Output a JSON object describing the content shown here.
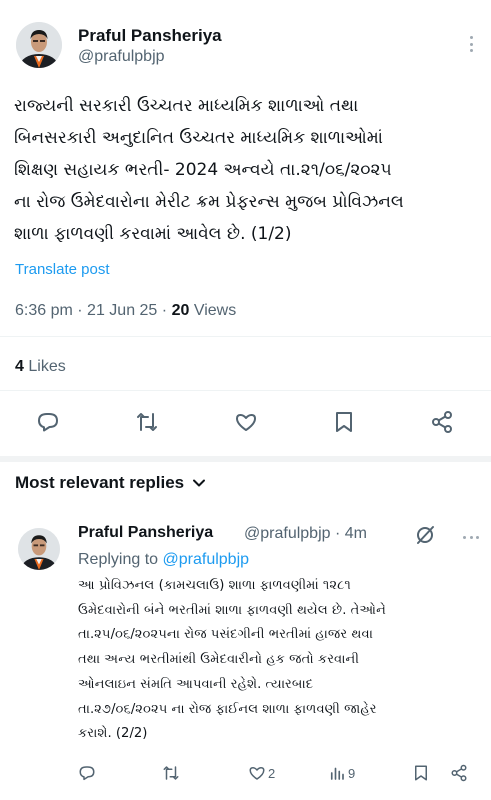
{
  "post": {
    "author_name": "Praful Pansheriya",
    "author_handle": "@prafulpbjp",
    "body_lines": [
      "રાજ્યની સરકારી ઉચ્ચતર માધ્યમિક શાળાઓ તથા",
      "બિનસરકારી અનુદાનિત ઉચ્ચતર માધ્યમિક શાળાઓમાં",
      "શિક્ષણ સહાયક ભરતી- 2024 અન્વયે તા.૨૧/૦૬/૨૦૨૫",
      "ના રોજ ઉમેદવારોના મેરીટ ક્રમ પ્રેફરન્સ મુજબ પ્રોવિઝનલ",
      "શાળા ફાળવણી કરવામાં આવેલ છે. (1/2)"
    ],
    "translate_label": "Translate post",
    "time": "6:36 pm",
    "date": "21 Jun 25",
    "views_count": "20",
    "views_label": "Views",
    "likes_count": "4",
    "likes_label": "Likes"
  },
  "action_icons": [
    "reply-icon",
    "repost-icon",
    "like-icon",
    "bookmark-icon",
    "share-icon"
  ],
  "replies_header": "Most relevant replies",
  "reply": {
    "author_name": "Praful Pansheriya",
    "author_handle": "@prafulpbjp",
    "age": "4m",
    "replying_prefix": "Replying to",
    "replying_handle": "@prafulpbjp",
    "body_lines": [
      "આ પ્રોવિઝનલ (કામચલાઉ) શાળા ફાળવણીમાં ૧૨૮૧",
      "ઉમેદવારોની બંને ભરતીમાં શાળા ફાળવણી થયેલ છે. તેઓને",
      "તા.૨૫/૦૬/૨૦૨૫ના રોજ પસંદગીની ભરતીમાં હાજર થવા",
      "તથા અન્ય ભરતીમાંથી ઉમેદવારીનો હક જતો કરવાની",
      "ઓનલાઇન સંમતિ આપવાની રહેશે. ત્યારબાદ",
      "તા.૨૭/૦૬/૨૦૨૫ ના રોજ ફાઈનલ શાળા ફાળવણી જાહેર",
      "કરાશે. (2/2)"
    ],
    "likes": "2",
    "views": "9"
  },
  "colors": {
    "accent": "#1d9bf0",
    "text_primary": "#0f1419",
    "text_secondary": "#536471",
    "divider": "#eff3f4"
  }
}
